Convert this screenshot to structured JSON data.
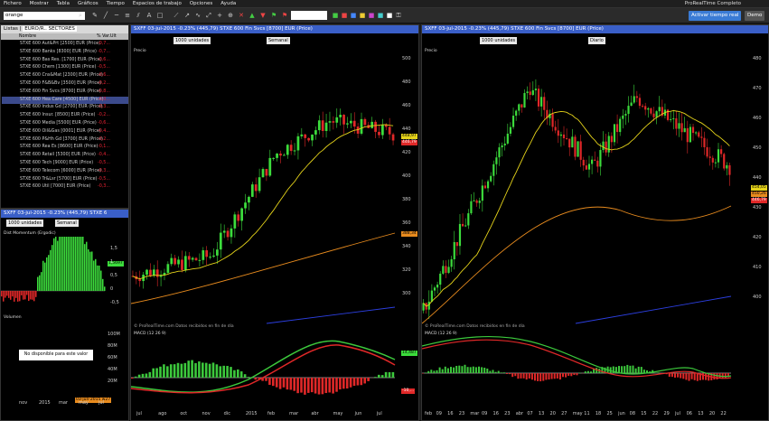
{
  "menu": {
    "items": [
      "Fichero",
      "Mostrar",
      "Tabla",
      "Gráficos",
      "Tiempo",
      "Espacios de trabajo",
      "Opciones",
      "Ayuda"
    ],
    "brand": "ProRealTime Completo"
  },
  "toolbar": {
    "search_value": "orange",
    "activate_label": "Activar tiempo real",
    "demo_label": "Demo"
  },
  "list": {
    "title": "Listas",
    "list_name": "EURO/R.. SECTORES",
    "col_name": "Nombre",
    "col_var": "% Var.Ult",
    "rows": [
      {
        "name": "STXE 600 Aut&Prt [2500] EUR (Price)",
        "var": "-0,7..."
      },
      {
        "name": "STXE 600 Banks [8300] EUR (Price)",
        "var": "-0,7..."
      },
      {
        "name": "STXE 600 Bas Res. [1700] EUR (Price)",
        "var": "-0,6..."
      },
      {
        "name": "STXE 600 Chem [1300] EUR (Price)",
        "var": "-0,5..."
      },
      {
        "name": "STXE 600 Cns&Mat [2300] EUR (Price)",
        "var": "-0,6..."
      },
      {
        "name": "STXE 600 F&B&Bv [3500] EUR (Price)",
        "var": "-0,2..."
      },
      {
        "name": "STXE 600 Fin Svcs [8700] EUR (Price)",
        "var": "-0,8..."
      },
      {
        "name": "STXE 600 Hea Care [4500] EUR (Price)",
        "var": "-0,0..."
      },
      {
        "name": "STXE 600 Indus Gd [2700] EUR (Price)",
        "var": "-0,3..."
      },
      {
        "name": "STXE 600 Insur. [8500] EUR (Price)",
        "var": "-0,2..."
      },
      {
        "name": "STXE 600 Media [5500] EUR (Price)",
        "var": "-0,6..."
      },
      {
        "name": "STXE 600 Oil&Gas [0001] EUR (Price)",
        "var": "-0,4..."
      },
      {
        "name": "STXE 600 P&Hh Gd [3700] EUR (Price)",
        "var": "-0,2..."
      },
      {
        "name": "STXE 600 Rea Es [8600] EUR (Price)",
        "var": "-0,1..."
      },
      {
        "name": "STXE 600 Retail [5300] EUR (Price)",
        "var": "-0,4..."
      },
      {
        "name": "STXE 600 Tech [9000] EUR (Price)",
        "var": "-0,5..."
      },
      {
        "name": "STXE 600 Telecom [6000] EUR (Price)",
        "var": "-0,3..."
      },
      {
        "name": "STXE 600 Tr&Lsr [5700] EUR (Price)",
        "var": "-0,5..."
      },
      {
        "name": "STXE 600 Util [7000] EUR (Price)",
        "var": "-0,3..."
      }
    ]
  },
  "small_chart": {
    "header": "SXFF  03-jul-2015  -0.23% (445,79)  STXE 6",
    "units": "1000 unidades",
    "period": "Semanal",
    "indicator_label": "Dist Momentum (Ergodic)",
    "value_badge": "1,5697",
    "y_labels": [
      "1,5",
      "1",
      "0,5",
      "0",
      "-0,5"
    ],
    "vol_label": "Volumen",
    "no_data": "No disponible para este valor",
    "vol_ticks": [
      "100M",
      "80M",
      "60M",
      "40M",
      "20M"
    ],
    "x_labels": [
      "nov",
      "2015",
      "mar",
      "may",
      "jul"
    ],
    "date_badge": "03-jun-2015 w27"
  },
  "chart_left": {
    "header": "SXFF  03-jul-2015  -0.23% (445,79)  STXE 600 Fin Svcs [8700] EUR (Price)",
    "units": "1000 unidades",
    "period": "Semanal",
    "price_label": "Precio",
    "y_labels": [
      "500",
      "480",
      "460",
      "440",
      "420",
      "400",
      "380",
      "360",
      "340",
      "320",
      "300"
    ],
    "badges": [
      "448,97",
      "446,79",
      "388,34"
    ],
    "credit": "© ProRealTime.com  Datos recibidos en fin de día",
    "macd_label": "MACD (12 26 9)",
    "macd_badges": [
      "14,487",
      "-10,..."
    ],
    "x_labels": [
      "jul",
      "ago",
      "oct",
      "nov",
      "dic",
      "2015",
      "feb",
      "mar",
      "abr",
      "may",
      "jun",
      "jul"
    ]
  },
  "chart_right": {
    "header": "SXFF  03-jul-2015  -0.23% (445,79)  STXE 600 Fin Svcs [8700] EUR (Price)",
    "units": "1000 unidades",
    "period": "Diario",
    "price_label": "Precio",
    "y_labels": [
      "480",
      "470",
      "460",
      "450",
      "440",
      "430",
      "420",
      "410",
      "400"
    ],
    "badges": [
      "454,05",
      "450,26",
      "446,79"
    ],
    "credit": "© ProRealTime.com  Datos recibidos en fin de día",
    "macd_label": "MACD (12 26 9)",
    "x_labels": [
      "feb",
      "09",
      "16",
      "23",
      "mar",
      "09",
      "16",
      "23",
      "abr",
      "07",
      "13",
      "20",
      "27",
      "may",
      "11",
      "18",
      "25",
      "jun",
      "08",
      "15",
      "22",
      "29",
      "jul",
      "06",
      "13",
      "20",
      "22"
    ]
  },
  "colors": {
    "up": "#3cdc3c",
    "down": "#e02828",
    "ma_short": "#e5d31a",
    "ma_long": "#e88b1e",
    "ma_xlong": "#2c3fe0",
    "macd_up": "#3cc83c",
    "macd_down": "#e02828"
  }
}
